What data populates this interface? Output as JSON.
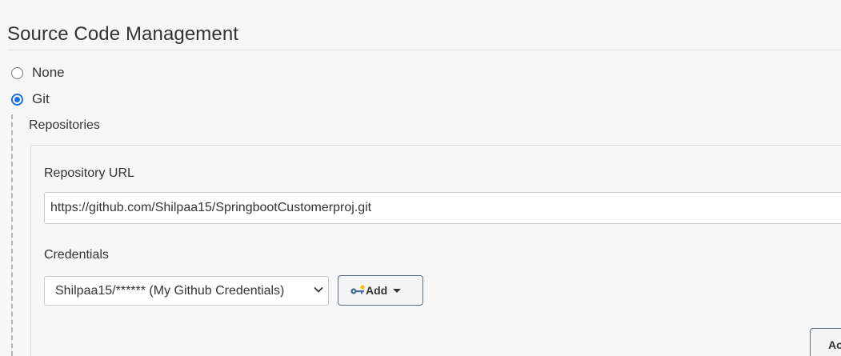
{
  "section": {
    "title": "Source Code Management"
  },
  "scm_options": [
    {
      "label": "None",
      "checked": false
    },
    {
      "label": "Git",
      "checked": true
    }
  ],
  "repositories": {
    "heading": "Repositories",
    "repository_url": {
      "label": "Repository URL",
      "value": "https://github.com/Shilpaa15/SpringbootCustomerproj.git"
    },
    "credentials": {
      "label": "Credentials",
      "selected": "Shilpaa15/****** (My Github Credentials)",
      "add_button_label": "Add",
      "add_button_icon": "key-icon"
    },
    "partial_button_label": "Ac"
  },
  "colors": {
    "accent": "#1a6fe0",
    "button_border": "#5a6b80"
  }
}
